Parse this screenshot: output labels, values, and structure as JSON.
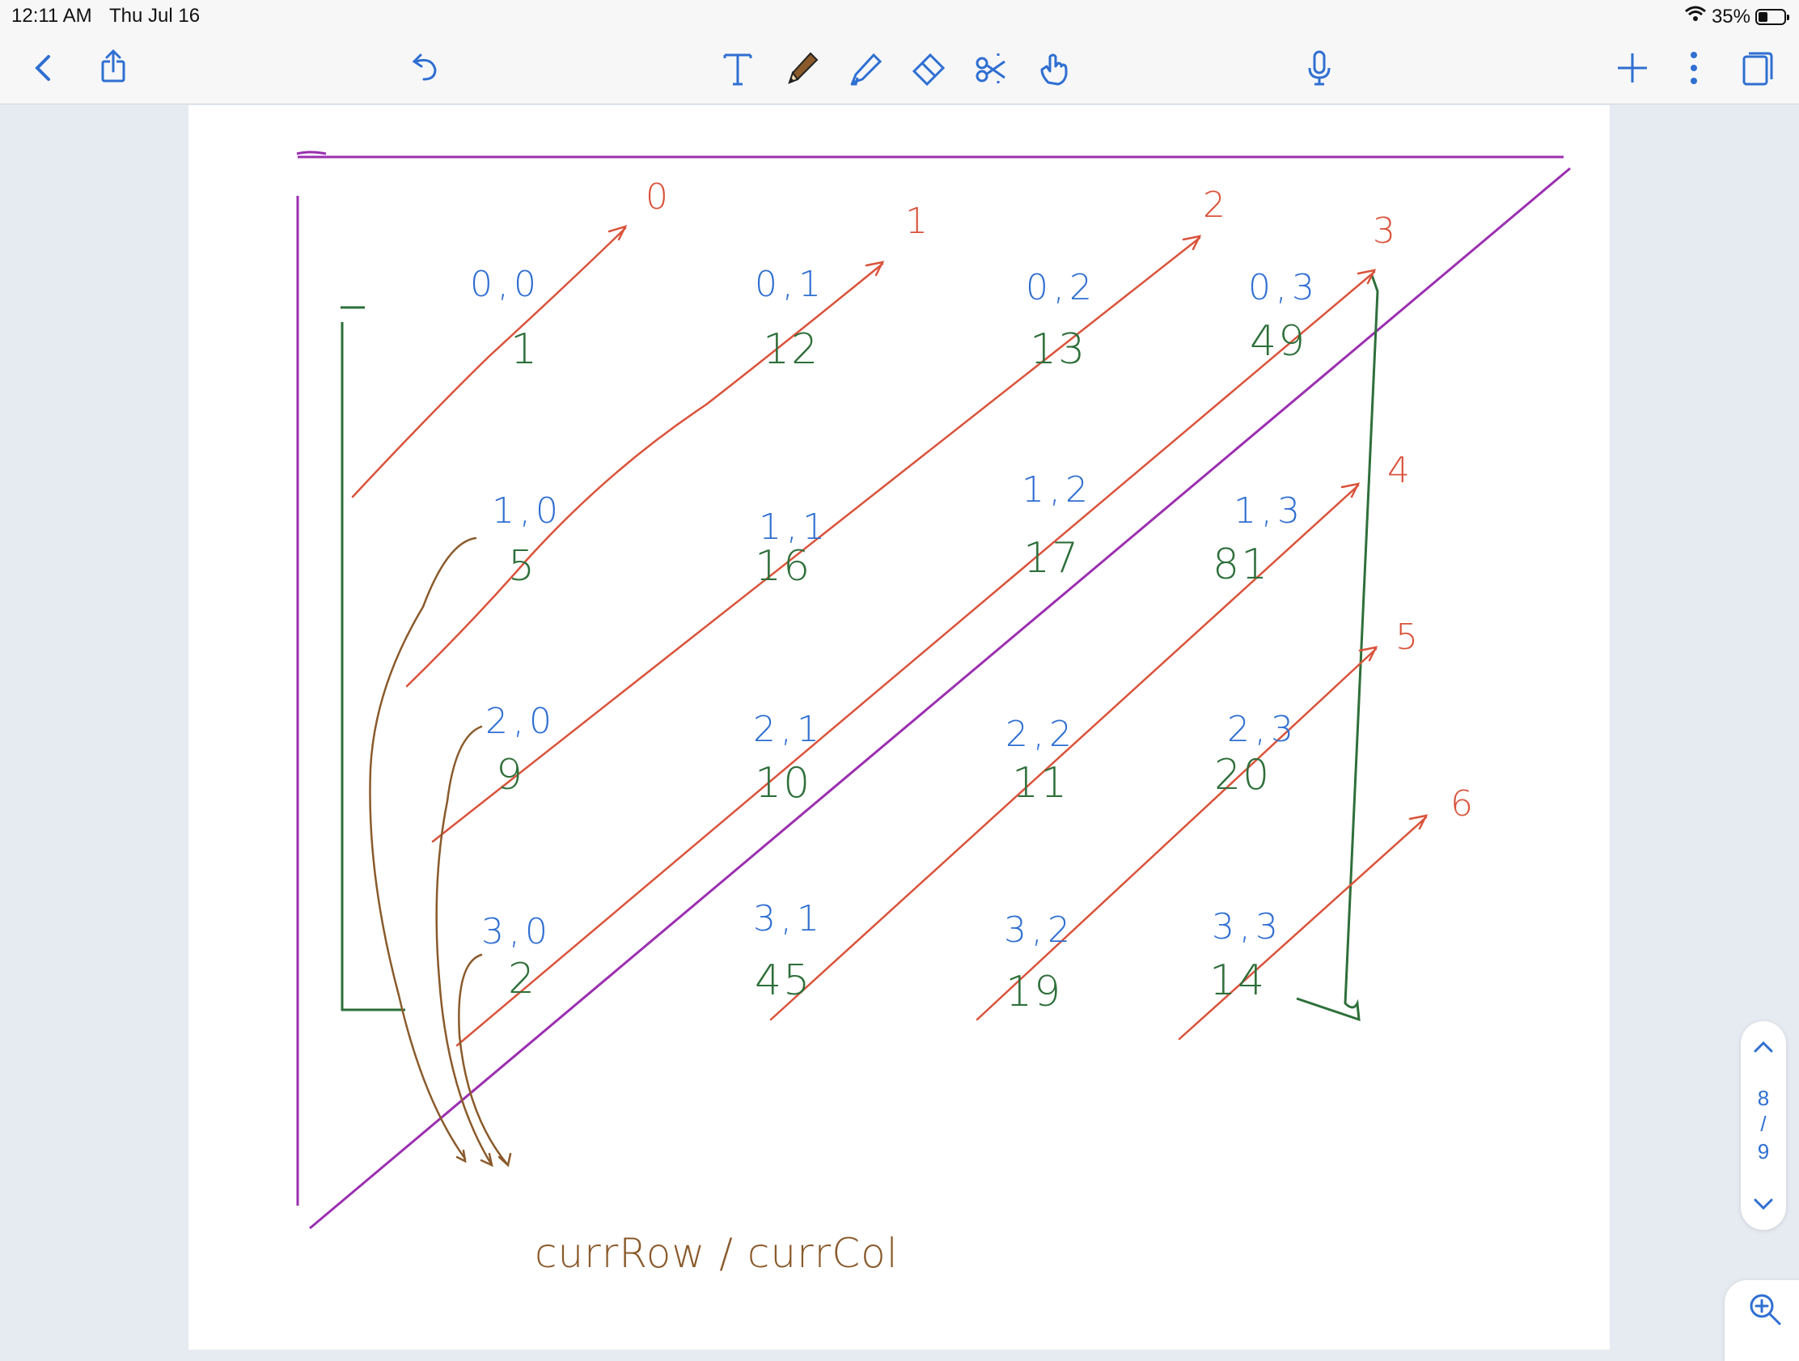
{
  "status": {
    "time": "12:11 AM",
    "date": "Thu Jul 16",
    "battery": "35%",
    "battery_level": 0.35
  },
  "toolbar": {
    "left": [
      "back-icon",
      "share-icon",
      "undo-icon"
    ],
    "tools": [
      "text-tool-icon",
      "pencil-icon",
      "highlighter-icon",
      "eraser-icon",
      "lasso-scissors-icon",
      "hand-pointer-icon"
    ],
    "right": [
      "microphone-icon",
      "add-icon",
      "more-icon",
      "pages-icon"
    ]
  },
  "colors": {
    "accent": "#2f6fd1",
    "coord": "#2f6fd1",
    "value": "#2e6f3a",
    "diag": "#d9533b",
    "border": "#9b2fb0",
    "caption": "#8a5a2b"
  },
  "grid": [
    {
      "coord": "0,0",
      "value": "1"
    },
    {
      "coord": "0,1",
      "value": "12"
    },
    {
      "coord": "0,2",
      "value": "13"
    },
    {
      "coord": "0,3",
      "value": "49"
    },
    {
      "coord": "1,0",
      "value": "5"
    },
    {
      "coord": "1,1",
      "value": "16"
    },
    {
      "coord": "1,2",
      "value": "17"
    },
    {
      "coord": "1,3",
      "value": "81"
    },
    {
      "coord": "2,0",
      "value": "9"
    },
    {
      "coord": "2,1",
      "value": "10"
    },
    {
      "coord": "2,2",
      "value": "11"
    },
    {
      "coord": "2,3",
      "value": "20"
    },
    {
      "coord": "3,0",
      "value": "2"
    },
    {
      "coord": "3,1",
      "value": "45"
    },
    {
      "coord": "3,2",
      "value": "19"
    },
    {
      "coord": "3,3",
      "value": "14"
    }
  ],
  "diagonals": [
    "0",
    "1",
    "2",
    "3",
    "4",
    "5",
    "6"
  ],
  "caption": "currRow / currCol",
  "pager": {
    "current": "8",
    "sep": "/",
    "total": "9"
  }
}
